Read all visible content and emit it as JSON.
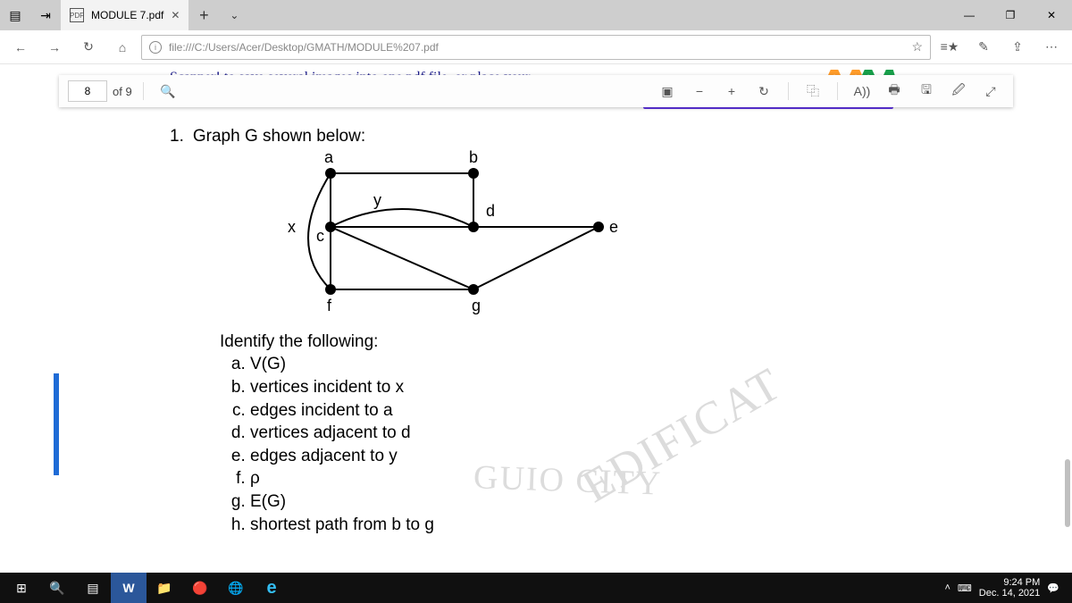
{
  "titlebar": {
    "tab_title": "MODULE 7.pdf"
  },
  "address": {
    "url": "file:///C:/Users/Acer/Desktop/GMATH/MODULE%207.pdf"
  },
  "pdfbar": {
    "page": "8",
    "of_label": "of 9",
    "read_aloud": "A))"
  },
  "peek_text": "Scanner! to save several images into one pdf file, or place your",
  "doc": {
    "heading_num": "1.",
    "heading": " Graph G shown below:",
    "labels": {
      "a": "a",
      "b": "b",
      "c": "c",
      "d": "d",
      "e": "e",
      "f": "f",
      "g": "g",
      "x": "x",
      "y": "y"
    },
    "identify": "Identify the following:",
    "qa": "V(G)",
    "qb": "vertices incident to x",
    "qc": "edges incident to a",
    "qd": "vertices adjacent to d",
    "qe": "edges adjacent to y",
    "qf": "ρ",
    "qg": "E(G)",
    "qh": "shortest path from b to g"
  },
  "watermark": {
    "w1": "EDIFICAT",
    "w2": "GUIO CITY"
  },
  "tray": {
    "time": "9:24 PM",
    "date": "Dec. 14, 2021"
  }
}
